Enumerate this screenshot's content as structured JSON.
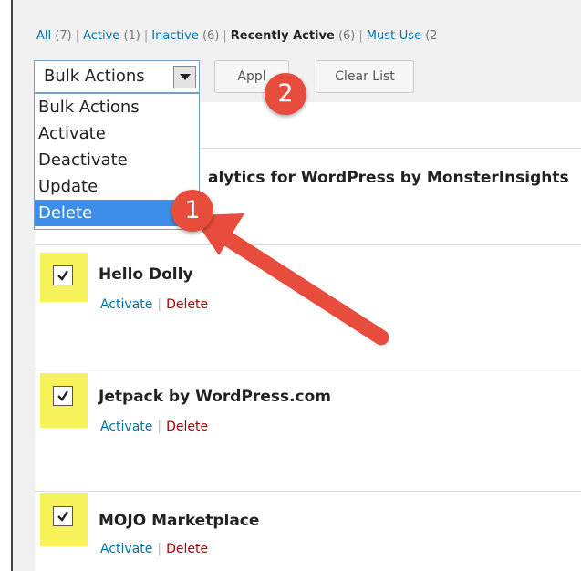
{
  "filters": {
    "all": "All",
    "all_count": "(7)",
    "active": "Active",
    "active_count": "(1)",
    "inactive": "Inactive",
    "inactive_count": "(6)",
    "recently_active": "Recently Active",
    "recently_active_count": "(6)",
    "must_use": "Must-Use",
    "must_use_count": "(2"
  },
  "toolbar": {
    "bulk_select_value": "Bulk Actions",
    "apply_label": "Appl",
    "clear_label": "Clear List"
  },
  "dropdown": {
    "options": [
      "Bulk Actions",
      "Activate",
      "Deactivate",
      "Update",
      "Delete"
    ],
    "selected": "Delete"
  },
  "plugins": [
    {
      "name": "alytics for WordPress by MonsterInsights",
      "checked": false
    },
    {
      "name": "Hello Dolly",
      "activate": "Activate",
      "delete": "Delete",
      "checked": true
    },
    {
      "name": "Jetpack by WordPress.com",
      "activate": "Activate",
      "delete": "Delete",
      "checked": true
    },
    {
      "name": "MOJO Marketplace",
      "activate": "Activate",
      "delete": "Delete",
      "checked": true
    }
  ],
  "annotations": {
    "step1": "1",
    "step2": "2",
    "color": "#e74c3c",
    "highlight_color": "#f8f25a"
  },
  "colors": {
    "link": "#0073aa",
    "delete": "#a00000",
    "dropdown_selected": "#3d8ee8"
  }
}
